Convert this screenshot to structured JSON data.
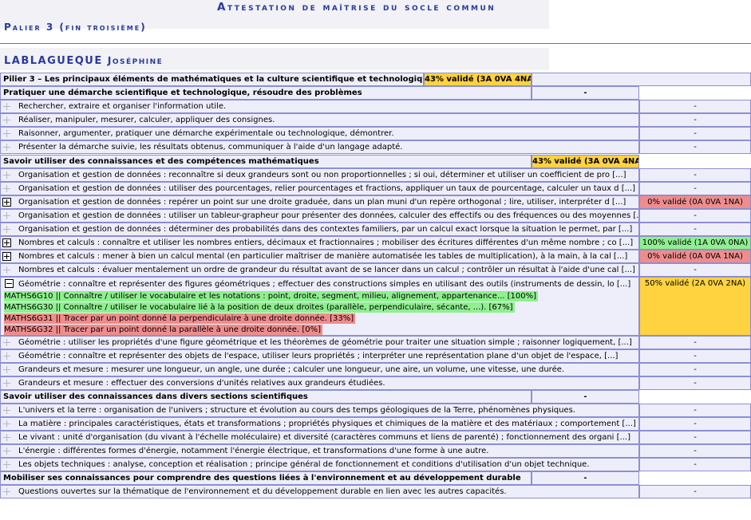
{
  "header": {
    "title": "Attestation de maîtrise du socle commun",
    "subtitle": "Palier 3 (fin troisième)",
    "student_last": "LABLAGUEQUE",
    "student_first": "Joséphine"
  },
  "pilier": {
    "label": "Pilier 3 – Les principaux éléments de mathématiques et la culture scientifique et technologique",
    "status": "43% validé (3A 0VA 4NA)"
  },
  "sections": [
    {
      "title": "Pratiquer une démarche scientifique et technologique, résoudre des problèmes",
      "status": "-",
      "items": [
        {
          "text": "Rechercher, extraire et organiser l'information utile.",
          "status": "-"
        },
        {
          "text": "Réaliser, manipuler, mesurer, calculer, appliquer des consignes.",
          "status": "-"
        },
        {
          "text": "Raisonner, argumenter, pratiquer une démarche expérimentale ou technologique, démontrer.",
          "status": "-"
        },
        {
          "text": "Présenter la démarche suivie, les résultats obtenus, communiquer à l'aide d'un langage adapté.",
          "status": "-"
        }
      ]
    },
    {
      "title": "Savoir utiliser des connaissances et des compétences mathématiques",
      "status": "43% validé (3A 0VA 4NA)",
      "items": [
        {
          "text": "Organisation et gestion de données : reconnaître si deux grandeurs sont ou non proportionnelles ; si oui, déterminer et utiliser un coefficient de pro [...]",
          "status": "-"
        },
        {
          "text": "Organisation et gestion de données : utiliser des pourcentages, relier pourcentages et fractions, appliquer un taux de pourcentage, calculer un taux d [...]",
          "status": "-"
        },
        {
          "text": "Organisation et gestion de données : repérer un point sur une droite graduée, dans un plan muni d'un repère orthogonal ; lire, utiliser, interpréter d [...]",
          "status": "0% validé (0A 0VA 1NA)"
        },
        {
          "text": "Organisation et gestion de données : utiliser un tableur-grapheur pour présenter des données, calculer des effectifs ou des fréquences ou des moyennes [...]",
          "status": "-"
        },
        {
          "text": "Organisation et gestion de données : déterminer des probabilités dans des contextes familiers, par un calcul exact lorsque la situation le permet, par [...]",
          "status": "-"
        },
        {
          "text": "Nombres et calculs : connaître et utiliser les nombres entiers, décimaux et fractionnaires ; mobiliser des écritures différentes d'un même nombre ; co [...]",
          "status": "100% validé (1A 0VA 0NA)"
        },
        {
          "text": "Nombres et calculs : mener à bien un calcul mental (en particulier maîtriser de manière automatisée les tables de multiplication), à la main, à la cal [...]",
          "status": "0% validé (0A 0VA 1NA)"
        },
        {
          "text": "Nombres et calculs : évaluer mentalement un ordre de grandeur du résultat avant de se lancer dans un calcul ; contrôler un résultat à l'aide d'une cal [...]",
          "status": "-"
        },
        {
          "text": "Géométrie : connaître et représenter des figures géométriques ; effectuer des constructions simples en utilisant des outils (instruments de dessin, lo [...]",
          "status": "50% validé (2A 0VA 2NA)"
        },
        {
          "text": "Géométrie : utiliser les propriétés d'une figure géométrique et les théorèmes de géométrie pour traiter une situation simple ; raisonner logiquement, [...]",
          "status": "-"
        },
        {
          "text": "Géométrie : connaître et représenter des objets de l'espace, utiliser leurs propriétés ; interpréter une représentation plane d'un objet de l'espace, [...]",
          "status": "-"
        },
        {
          "text": "Grandeurs et mesure : mesurer une longueur, un angle, une durée ; calculer une longueur, une aire, un volume, une vitesse, une durée.",
          "status": "-"
        },
        {
          "text": "Grandeurs et mesure : effectuer des conversions d'unités relatives aux grandeurs étudiées.",
          "status": "-"
        }
      ]
    },
    {
      "title": "Savoir utiliser des connaissances dans divers sections scientifiques",
      "status": "-",
      "items": [
        {
          "text": "L'univers et la terre : organisation de l'univers ; structure et évolution au cours des temps géologiques de la Terre, phénomènes physiques.",
          "status": "-"
        },
        {
          "text": "La matière : principales caractéristiques, états et transformations ; propriétés physiques et chimiques de la matière et des matériaux ; comportement [...]",
          "status": "-"
        },
        {
          "text": "Le vivant : unité d'organisation (du vivant à l'échelle moléculaire) et diversité (caractères communs et liens de parenté) ; fonctionnement des organi [...]",
          "status": "-"
        },
        {
          "text": "L'énergie : différentes formes d'énergie, notamment l'énergie électrique, et transformations d'une forme à une autre.",
          "status": "-"
        },
        {
          "text": "Les objets techniques : analyse, conception et réalisation ; principe général de fonctionnement et conditions d'utilisation d'un objet technique.",
          "status": "-"
        }
      ]
    },
    {
      "title": "Mobiliser ses connaissances pour comprendre des questions liées à l'environnement et au développement durable",
      "status": "-",
      "items": [
        {
          "text": "Questions ouvertes sur la thématique de l'environnement et du développement durable en lien avec les autres capacités.",
          "status": "-"
        }
      ]
    }
  ],
  "details": [
    "MATHS6G10 || Connaître / utiliser le vocabulaire et les notations : point, droite, segment, milieu, alignement, appartenance... [100%]",
    "MATHS6G30 || Connaître / utiliser le vocabulaire lié à la position de deux droites (parallèle, perpendiculaire, sécante, ...). [67%]",
    "MATHS6G31 || Tracer par un point donné la perpendiculaire à une droite donnée. [33%]",
    "MATHS6G32 || Tracer par un point donné la parallèle à une droite donnée. [0%]"
  ],
  "colors": {
    "validated_partial": "#ffd23f",
    "validated_full": "#8ef08e",
    "not_validated": "#f08c8c",
    "cell_bg": "#eeeefb",
    "border": "#8c8fd0",
    "heading": "#2a3a9e"
  }
}
